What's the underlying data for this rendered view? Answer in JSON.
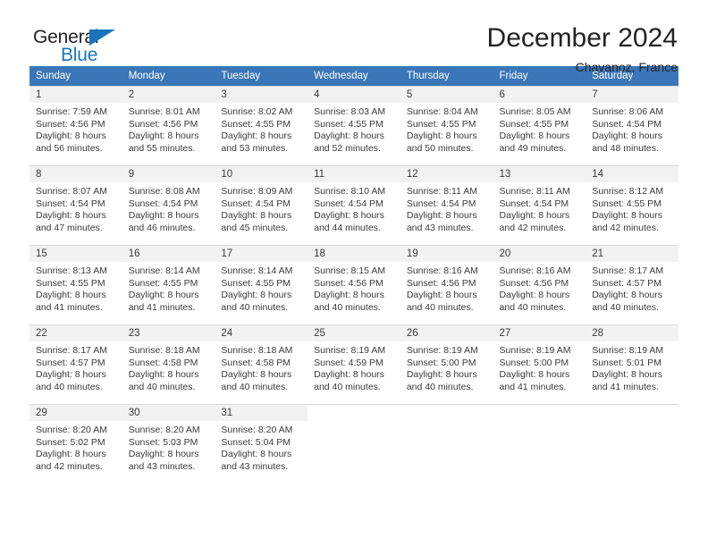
{
  "brand": {
    "name_part1": "General",
    "name_part2": "Blue",
    "flag_icon": "triangle-flag-icon"
  },
  "header": {
    "month_title": "December 2024",
    "location": "Chavanoz, France"
  },
  "colors": {
    "header_blue": "#3a76b8",
    "brand_blue": "#1a74bb",
    "daynum_bg": "#f2f2f2",
    "grid_line": "#d9d9d9",
    "text": "#3a3a3a"
  },
  "calendar": {
    "weekdays": [
      "Sunday",
      "Monday",
      "Tuesday",
      "Wednesday",
      "Thursday",
      "Friday",
      "Saturday"
    ],
    "weeks": [
      [
        {
          "day": "1",
          "sunrise": "Sunrise: 7:59 AM",
          "sunset": "Sunset: 4:56 PM",
          "daylight_line1": "Daylight: 8 hours",
          "daylight_line2": "and 56 minutes."
        },
        {
          "day": "2",
          "sunrise": "Sunrise: 8:01 AM",
          "sunset": "Sunset: 4:56 PM",
          "daylight_line1": "Daylight: 8 hours",
          "daylight_line2": "and 55 minutes."
        },
        {
          "day": "3",
          "sunrise": "Sunrise: 8:02 AM",
          "sunset": "Sunset: 4:55 PM",
          "daylight_line1": "Daylight: 8 hours",
          "daylight_line2": "and 53 minutes."
        },
        {
          "day": "4",
          "sunrise": "Sunrise: 8:03 AM",
          "sunset": "Sunset: 4:55 PM",
          "daylight_line1": "Daylight: 8 hours",
          "daylight_line2": "and 52 minutes."
        },
        {
          "day": "5",
          "sunrise": "Sunrise: 8:04 AM",
          "sunset": "Sunset: 4:55 PM",
          "daylight_line1": "Daylight: 8 hours",
          "daylight_line2": "and 50 minutes."
        },
        {
          "day": "6",
          "sunrise": "Sunrise: 8:05 AM",
          "sunset": "Sunset: 4:55 PM",
          "daylight_line1": "Daylight: 8 hours",
          "daylight_line2": "and 49 minutes."
        },
        {
          "day": "7",
          "sunrise": "Sunrise: 8:06 AM",
          "sunset": "Sunset: 4:54 PM",
          "daylight_line1": "Daylight: 8 hours",
          "daylight_line2": "and 48 minutes."
        }
      ],
      [
        {
          "day": "8",
          "sunrise": "Sunrise: 8:07 AM",
          "sunset": "Sunset: 4:54 PM",
          "daylight_line1": "Daylight: 8 hours",
          "daylight_line2": "and 47 minutes."
        },
        {
          "day": "9",
          "sunrise": "Sunrise: 8:08 AM",
          "sunset": "Sunset: 4:54 PM",
          "daylight_line1": "Daylight: 8 hours",
          "daylight_line2": "and 46 minutes."
        },
        {
          "day": "10",
          "sunrise": "Sunrise: 8:09 AM",
          "sunset": "Sunset: 4:54 PM",
          "daylight_line1": "Daylight: 8 hours",
          "daylight_line2": "and 45 minutes."
        },
        {
          "day": "11",
          "sunrise": "Sunrise: 8:10 AM",
          "sunset": "Sunset: 4:54 PM",
          "daylight_line1": "Daylight: 8 hours",
          "daylight_line2": "and 44 minutes."
        },
        {
          "day": "12",
          "sunrise": "Sunrise: 8:11 AM",
          "sunset": "Sunset: 4:54 PM",
          "daylight_line1": "Daylight: 8 hours",
          "daylight_line2": "and 43 minutes."
        },
        {
          "day": "13",
          "sunrise": "Sunrise: 8:11 AM",
          "sunset": "Sunset: 4:54 PM",
          "daylight_line1": "Daylight: 8 hours",
          "daylight_line2": "and 42 minutes."
        },
        {
          "day": "14",
          "sunrise": "Sunrise: 8:12 AM",
          "sunset": "Sunset: 4:55 PM",
          "daylight_line1": "Daylight: 8 hours",
          "daylight_line2": "and 42 minutes."
        }
      ],
      [
        {
          "day": "15",
          "sunrise": "Sunrise: 8:13 AM",
          "sunset": "Sunset: 4:55 PM",
          "daylight_line1": "Daylight: 8 hours",
          "daylight_line2": "and 41 minutes."
        },
        {
          "day": "16",
          "sunrise": "Sunrise: 8:14 AM",
          "sunset": "Sunset: 4:55 PM",
          "daylight_line1": "Daylight: 8 hours",
          "daylight_line2": "and 41 minutes."
        },
        {
          "day": "17",
          "sunrise": "Sunrise: 8:14 AM",
          "sunset": "Sunset: 4:55 PM",
          "daylight_line1": "Daylight: 8 hours",
          "daylight_line2": "and 40 minutes."
        },
        {
          "day": "18",
          "sunrise": "Sunrise: 8:15 AM",
          "sunset": "Sunset: 4:56 PM",
          "daylight_line1": "Daylight: 8 hours",
          "daylight_line2": "and 40 minutes."
        },
        {
          "day": "19",
          "sunrise": "Sunrise: 8:16 AM",
          "sunset": "Sunset: 4:56 PM",
          "daylight_line1": "Daylight: 8 hours",
          "daylight_line2": "and 40 minutes."
        },
        {
          "day": "20",
          "sunrise": "Sunrise: 8:16 AM",
          "sunset": "Sunset: 4:56 PM",
          "daylight_line1": "Daylight: 8 hours",
          "daylight_line2": "and 40 minutes."
        },
        {
          "day": "21",
          "sunrise": "Sunrise: 8:17 AM",
          "sunset": "Sunset: 4:57 PM",
          "daylight_line1": "Daylight: 8 hours",
          "daylight_line2": "and 40 minutes."
        }
      ],
      [
        {
          "day": "22",
          "sunrise": "Sunrise: 8:17 AM",
          "sunset": "Sunset: 4:57 PM",
          "daylight_line1": "Daylight: 8 hours",
          "daylight_line2": "and 40 minutes."
        },
        {
          "day": "23",
          "sunrise": "Sunrise: 8:18 AM",
          "sunset": "Sunset: 4:58 PM",
          "daylight_line1": "Daylight: 8 hours",
          "daylight_line2": "and 40 minutes."
        },
        {
          "day": "24",
          "sunrise": "Sunrise: 8:18 AM",
          "sunset": "Sunset: 4:58 PM",
          "daylight_line1": "Daylight: 8 hours",
          "daylight_line2": "and 40 minutes."
        },
        {
          "day": "25",
          "sunrise": "Sunrise: 8:19 AM",
          "sunset": "Sunset: 4:59 PM",
          "daylight_line1": "Daylight: 8 hours",
          "daylight_line2": "and 40 minutes."
        },
        {
          "day": "26",
          "sunrise": "Sunrise: 8:19 AM",
          "sunset": "Sunset: 5:00 PM",
          "daylight_line1": "Daylight: 8 hours",
          "daylight_line2": "and 40 minutes."
        },
        {
          "day": "27",
          "sunrise": "Sunrise: 8:19 AM",
          "sunset": "Sunset: 5:00 PM",
          "daylight_line1": "Daylight: 8 hours",
          "daylight_line2": "and 41 minutes."
        },
        {
          "day": "28",
          "sunrise": "Sunrise: 8:19 AM",
          "sunset": "Sunset: 5:01 PM",
          "daylight_line1": "Daylight: 8 hours",
          "daylight_line2": "and 41 minutes."
        }
      ],
      [
        {
          "day": "29",
          "sunrise": "Sunrise: 8:20 AM",
          "sunset": "Sunset: 5:02 PM",
          "daylight_line1": "Daylight: 8 hours",
          "daylight_line2": "and 42 minutes."
        },
        {
          "day": "30",
          "sunrise": "Sunrise: 8:20 AM",
          "sunset": "Sunset: 5:03 PM",
          "daylight_line1": "Daylight: 8 hours",
          "daylight_line2": "and 43 minutes."
        },
        {
          "day": "31",
          "sunrise": "Sunrise: 8:20 AM",
          "sunset": "Sunset: 5:04 PM",
          "daylight_line1": "Daylight: 8 hours",
          "daylight_line2": "and 43 minutes."
        },
        {
          "day": "",
          "sunrise": "",
          "sunset": "",
          "daylight_line1": "",
          "daylight_line2": ""
        },
        {
          "day": "",
          "sunrise": "",
          "sunset": "",
          "daylight_line1": "",
          "daylight_line2": ""
        },
        {
          "day": "",
          "sunrise": "",
          "sunset": "",
          "daylight_line1": "",
          "daylight_line2": ""
        },
        {
          "day": "",
          "sunrise": "",
          "sunset": "",
          "daylight_line1": "",
          "daylight_line2": ""
        }
      ]
    ]
  }
}
